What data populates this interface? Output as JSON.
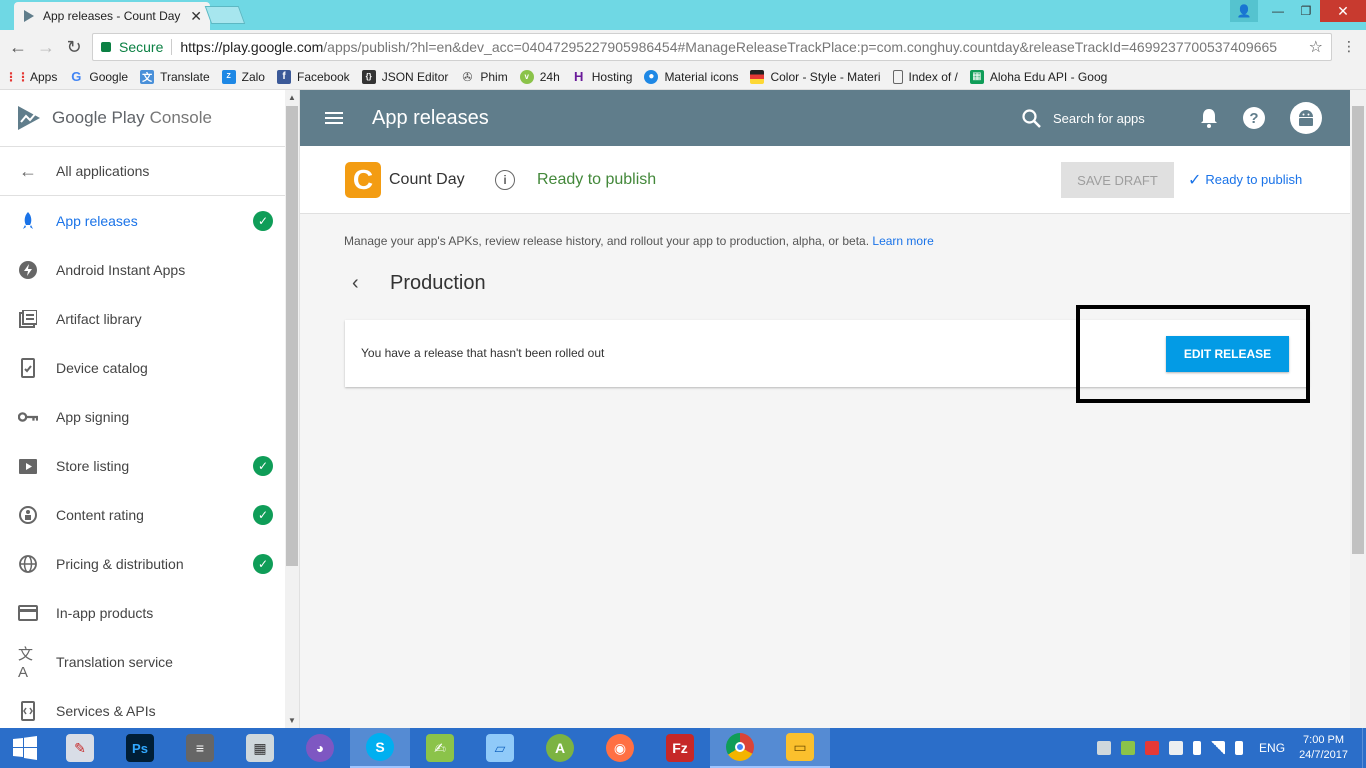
{
  "browser": {
    "tab_title": "App releases - Count Day",
    "secure_label": "Secure",
    "url_host": "https://play.google.com",
    "url_path": "/apps/publish/?hl=en&dev_acc=04047295227905986454#ManageReleaseTrackPlace:p=com.conghuy.countday&releaseTrackId=4699237700537409665",
    "bookmarks": [
      "Apps",
      "Google",
      "Translate",
      "Zalo",
      "Facebook",
      "JSON Editor",
      "Phim",
      "24h",
      "Hosting",
      "Material icons",
      "Color - Style - Materi",
      "Index of /",
      "Aloha Edu API - Goog"
    ]
  },
  "sidebar": {
    "brand": "Google Play",
    "brand_suffix": "Console",
    "back_label": "All applications",
    "items": [
      {
        "label": "App releases",
        "icon": "rocket-icon",
        "checked": true,
        "active": true
      },
      {
        "label": "Android Instant Apps",
        "icon": "bolt-icon",
        "checked": false
      },
      {
        "label": "Artifact library",
        "icon": "library-icon",
        "checked": false
      },
      {
        "label": "Device catalog",
        "icon": "device-icon",
        "checked": false
      },
      {
        "label": "App signing",
        "icon": "key-icon",
        "checked": false
      },
      {
        "label": "Store listing",
        "icon": "play-box-icon",
        "checked": true
      },
      {
        "label": "Content rating",
        "icon": "rating-icon",
        "checked": true
      },
      {
        "label": "Pricing & distribution",
        "icon": "globe-icon",
        "checked": true
      },
      {
        "label": "In-app products",
        "icon": "card-icon",
        "checked": false
      },
      {
        "label": "Translation service",
        "icon": "translate-icon",
        "checked": false
      },
      {
        "label": "Services & APIs",
        "icon": "api-icon",
        "checked": false
      }
    ]
  },
  "appbar": {
    "title": "App releases",
    "search_placeholder": "Search for apps"
  },
  "app": {
    "icon_letter": "C",
    "name": "Count Day",
    "status": "Ready to publish",
    "save_draft": "SAVE DRAFT",
    "ready_link": "Ready to publish"
  },
  "main": {
    "description": "Manage your app's APKs, review release history, and rollout your app to production, alpha, or beta.",
    "learn_more": "Learn more",
    "track_title": "Production",
    "card_message": "You have a release that hasn't been rolled out",
    "edit_release": "EDIT RELEASE"
  },
  "taskbar": {
    "language": "ENG",
    "time": "7:00 PM",
    "date": "24/7/2017"
  },
  "colors": {
    "accent": "#1a73e8",
    "appbar": "#607d8b",
    "success": "#0f9d58",
    "primary_button": "#039be5",
    "app_icon": "#f39c12"
  }
}
